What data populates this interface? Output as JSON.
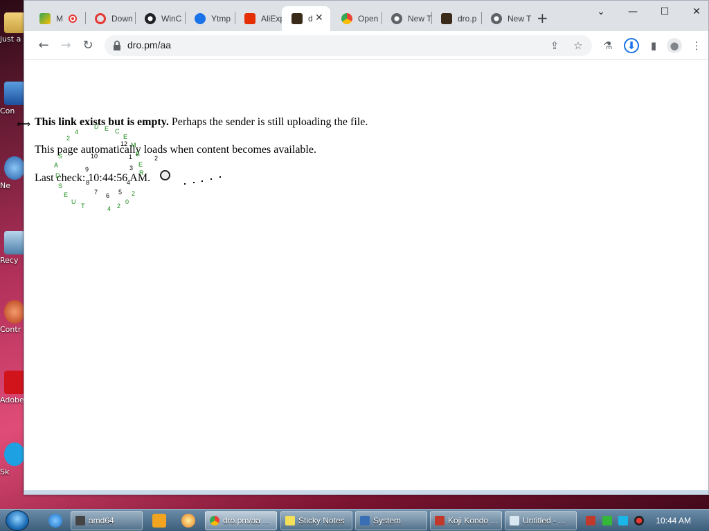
{
  "desktop": {
    "icons": [
      {
        "label": "just a m",
        "icon": "folder-icon"
      },
      {
        "label": "Con",
        "icon": "computer-icon"
      },
      {
        "label": "Ne",
        "icon": "network-icon"
      },
      {
        "label": "Recy",
        "icon": "recycle-bin-icon"
      },
      {
        "label": "Contr",
        "icon": "control-panel-icon"
      },
      {
        "label": "Adobe",
        "icon": "adobe-icon"
      },
      {
        "label": "Sk",
        "icon": "skype-icon"
      }
    ]
  },
  "browser": {
    "tabs": [
      {
        "label": "M",
        "icon": "gmeet-icon",
        "color": "#34a853"
      },
      {
        "label": "Down",
        "icon": "opera-icon",
        "color": "#e53935"
      },
      {
        "label": "WinC",
        "icon": "gear-icon",
        "color": "#202124"
      },
      {
        "label": "Ytmp",
        "icon": "ytmp-icon",
        "color": "#1a73e8"
      },
      {
        "label": "AliExp",
        "icon": "aliexpress-icon",
        "color": "#e62e04"
      },
      {
        "label": "d",
        "icon": "dro-icon",
        "color": "#3a2a1a",
        "active": true
      },
      {
        "label": "Open",
        "icon": "chrome-store-icon",
        "color": "#fbbc04"
      },
      {
        "label": "New T",
        "icon": "chrome-icon",
        "color": "#5f6368"
      },
      {
        "label": "dro.p",
        "icon": "dro-icon",
        "color": "#3a2a1a"
      },
      {
        "label": "New T",
        "icon": "chrome-icon",
        "color": "#5f6368"
      }
    ],
    "window_controls": {
      "dropdown": "⌄",
      "minimize": "—",
      "maximize": "☐",
      "close": "✕"
    },
    "new_tab": "+",
    "close_tab": "✕",
    "nav": {
      "back": "←",
      "forward": "→",
      "reload": "↻"
    },
    "url": "dro.pm/aa",
    "omnibox_icons": {
      "share": "⇪",
      "bookmark": "☆"
    },
    "toolbar_icons": {
      "extension": "⚗",
      "download": "⬇",
      "side_panel": "▮",
      "profile": "●",
      "menu": "⋮"
    }
  },
  "page": {
    "line1_bold": "This link exists but is empty.",
    "line1_rest": " Perhaps the sender is still uploading the file.",
    "line2": "This page automatically loads when content becomes available.",
    "line3": "Last check: 10:44:56 AM."
  },
  "trail": {
    "numbers": [
      "2",
      "4",
      "10",
      "9",
      "8",
      "7",
      "6",
      "5",
      "4",
      "3",
      "2",
      "12",
      "1",
      "2",
      "0",
      "4",
      "2"
    ],
    "letters": [
      "D",
      "E",
      "C",
      "E",
      "M",
      "B",
      "E",
      "R",
      "S",
      "A",
      "T",
      "U",
      "E",
      "S",
      "D"
    ]
  },
  "taskbar": {
    "items": [
      {
        "label": "amd64",
        "icon": "cmd-icon",
        "color": "#444"
      },
      {
        "label": "dro.pm/aa ...",
        "icon": "chrome-icon",
        "color": "#4caf50",
        "active": true
      },
      {
        "label": "Sticky Notes",
        "icon": "sticky-notes-icon",
        "color": "#f5e05a"
      },
      {
        "label": "System",
        "icon": "system-icon",
        "color": "#3b6fb5"
      },
      {
        "label": "Koji Kondo ...",
        "icon": "notes-icon",
        "color": "#c0392b"
      },
      {
        "label": "Untitled - ...",
        "icon": "notepad-icon",
        "color": "#d8e6f2"
      }
    ],
    "clock": "10:44 AM"
  }
}
